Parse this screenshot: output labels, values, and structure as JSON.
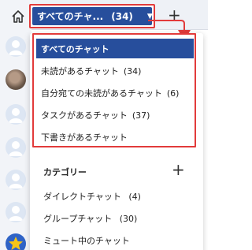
{
  "selector": {
    "label": "すべてのチャ...",
    "count": "(34)"
  },
  "menu": {
    "items": [
      {
        "label": "すべてのチャット",
        "count": ""
      },
      {
        "label": "未読があるチャット",
        "count": "(34)"
      },
      {
        "label": "自分宛ての未読があるチャット",
        "count": "(6)"
      },
      {
        "label": "タスクがあるチャット",
        "count": "(37)"
      },
      {
        "label": "下書きがあるチャット",
        "count": ""
      }
    ]
  },
  "categories": {
    "title": "カテゴリー",
    "items": [
      {
        "label": "ダイレクトチャット",
        "count": "(4)"
      },
      {
        "label": "グループチャット",
        "count": "(30)"
      },
      {
        "label": "ミュート中のチャット",
        "count": ""
      }
    ]
  },
  "colors": {
    "accent": "#274e9c",
    "highlight_border": "#e23b3b",
    "online_dot": "#3ec28f"
  }
}
